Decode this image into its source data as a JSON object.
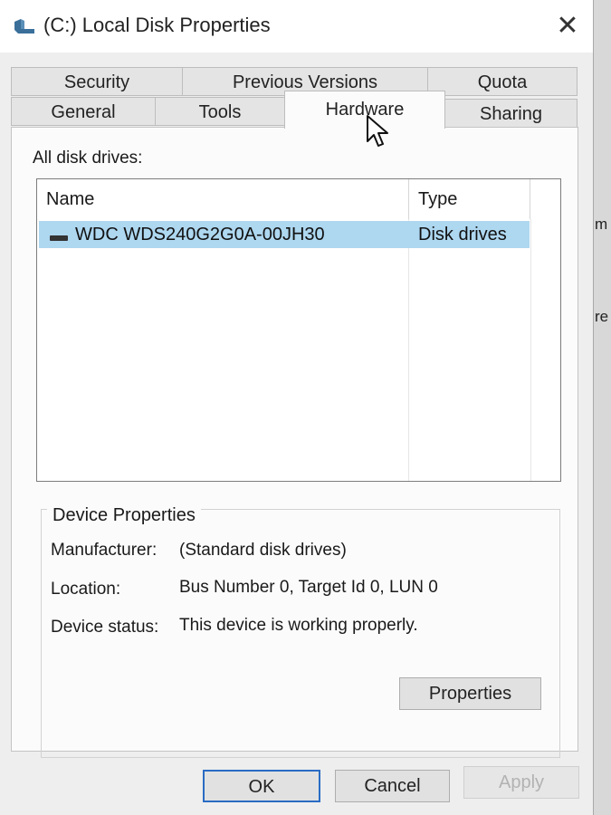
{
  "window": {
    "title": "(C:) Local Disk Properties",
    "close_label": "✕"
  },
  "tabs": {
    "row1": [
      {
        "id": "security",
        "label": "Security"
      },
      {
        "id": "previous-versions",
        "label": "Previous Versions"
      },
      {
        "id": "quota",
        "label": "Quota"
      }
    ],
    "row2": [
      {
        "id": "general",
        "label": "General"
      },
      {
        "id": "tools",
        "label": "Tools"
      },
      {
        "id": "hardware",
        "label": "Hardware",
        "active": true
      },
      {
        "id": "sharing",
        "label": "Sharing"
      }
    ]
  },
  "drives": {
    "label": "All disk drives:",
    "columns": [
      "Name",
      "Type"
    ],
    "rows": [
      {
        "name": "WDC WDS240G2G0A-00JH30",
        "type": "Disk drives",
        "selected": true,
        "icon": "drive-icon"
      }
    ]
  },
  "device": {
    "group_title": "Device Properties",
    "manufacturer_label": "Manufacturer:",
    "manufacturer_value": "(Standard disk drives)",
    "location_label": "Location:",
    "location_value": "Bus Number 0, Target Id 0, LUN 0",
    "status_label": "Device status:",
    "status_value": "This device is working properly.",
    "properties_button": "Properties"
  },
  "footer": {
    "ok": "OK",
    "cancel": "Cancel",
    "apply": "Apply"
  },
  "background_fragments": [
    "m",
    "re"
  ],
  "colors": {
    "selection": "#aed7f0",
    "default_button_border": "#2a6cc4"
  }
}
